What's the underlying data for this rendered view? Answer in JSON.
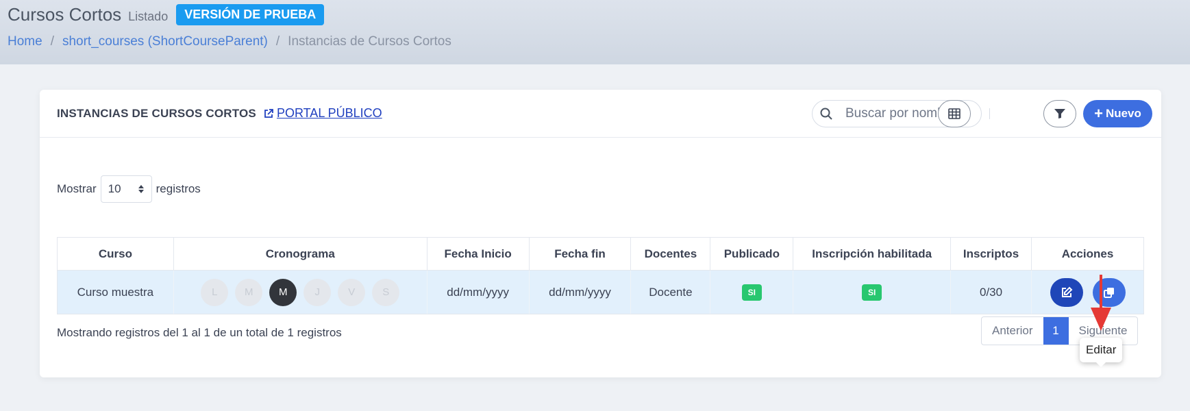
{
  "header": {
    "title": "Cursos Cortos",
    "subtitle": "Listado",
    "trial_badge": "VERSIÓN DE PRUEBA",
    "breadcrumb": [
      "Home",
      "short_courses (ShortCourseParent)",
      "Instancias de Cursos Cortos"
    ]
  },
  "card": {
    "title": "INSTANCIAS DE CURSOS CORTOS",
    "portal_link": "PORTAL PÚBLICO",
    "search_placeholder": "Buscar por nombre",
    "new_button": "Nuevo"
  },
  "length": {
    "prefix": "Mostrar",
    "value": "10",
    "suffix": "registros"
  },
  "table": {
    "headers": [
      "Curso",
      "Cronograma",
      "Fecha Inicio",
      "Fecha fin",
      "Docentes",
      "Publicado",
      "Inscripción habilitada",
      "Inscriptos",
      "Acciones"
    ],
    "rows": [
      {
        "curso": "Curso muestra",
        "days": [
          "L",
          "M",
          "M",
          "J",
          "V",
          "S"
        ],
        "active_day_index": 2,
        "fecha_inicio": "dd/mm/yyyy",
        "fecha_fin": "dd/mm/yyyy",
        "docentes": "Docente",
        "publicado": "SI",
        "inscripcion": "SI",
        "inscriptos": "0/30"
      }
    ]
  },
  "footer": {
    "info": "Mostrando registros del 1 al 1 de un total de 1 registros",
    "prev": "Anterior",
    "page": "1",
    "next": "Siguiente"
  },
  "tooltip": "Editar",
  "colors": {
    "primary": "#3d6ee0",
    "trial": "#1a9bf0",
    "success": "#28c76f",
    "arrow": "#e53935"
  }
}
